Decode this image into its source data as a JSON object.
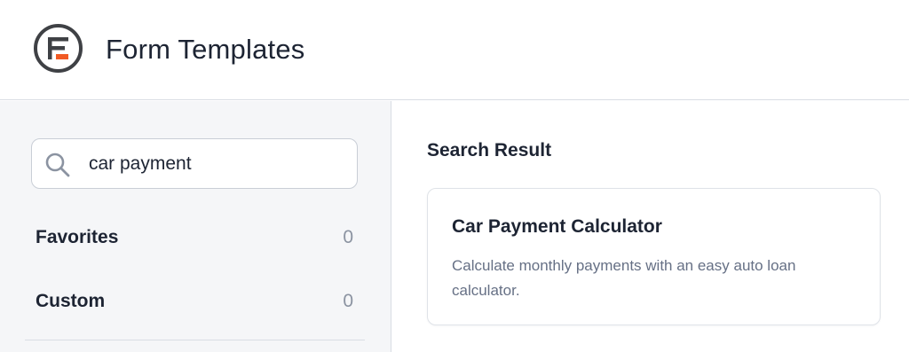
{
  "header": {
    "title": "Form Templates",
    "logo_icon": "formidable-logo-icon",
    "brand_color": "#3f4145",
    "accent_color": "#f15a24"
  },
  "sidebar": {
    "search": {
      "icon": "search-icon",
      "value": "car payment"
    },
    "categories": [
      {
        "label": "Favorites",
        "count": "0"
      },
      {
        "label": "Custom",
        "count": "0"
      }
    ]
  },
  "main": {
    "section_title": "Search Result",
    "results": [
      {
        "title": "Car Payment Calculator",
        "description": "Calculate monthly payments with an easy auto loan calculator."
      }
    ]
  }
}
